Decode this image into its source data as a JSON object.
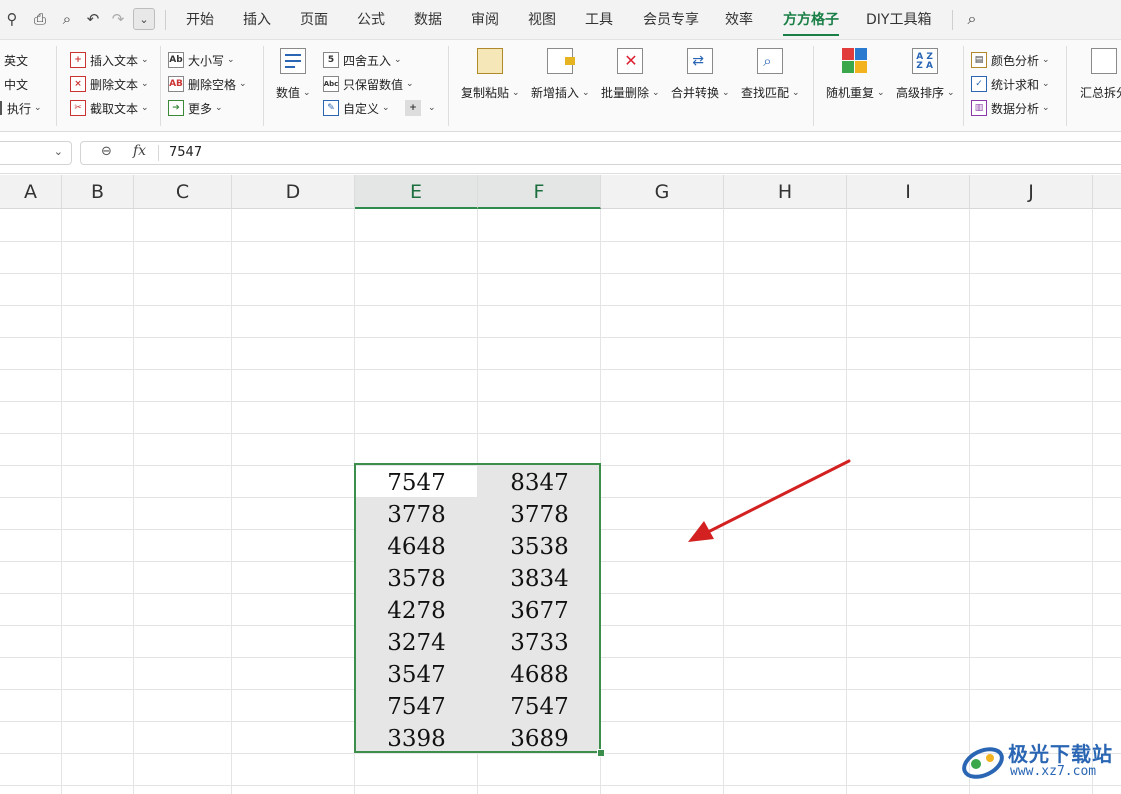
{
  "quick_access": [
    "pin-icon",
    "print-icon",
    "print-preview-icon",
    "undo-icon",
    "redo-icon"
  ],
  "tabs": [
    {
      "label": "开始",
      "active": false
    },
    {
      "label": "插入",
      "active": false
    },
    {
      "label": "页面",
      "active": false
    },
    {
      "label": "公式",
      "active": false
    },
    {
      "label": "数据",
      "active": false
    },
    {
      "label": "审阅",
      "active": false
    },
    {
      "label": "视图",
      "active": false
    },
    {
      "label": "工具",
      "active": false
    },
    {
      "label": "会员专享",
      "active": false
    },
    {
      "label": "效率",
      "active": false
    },
    {
      "label": "方方格子",
      "active": true
    },
    {
      "label": "DIY工具箱",
      "active": false
    }
  ],
  "ribbon": {
    "group1": [
      "英文",
      "中文",
      "执行"
    ],
    "group2": [
      "插入文本",
      "删除文本",
      "截取文本"
    ],
    "group3": [
      "大小写",
      "删除空格",
      "更多"
    ],
    "numeric_button": "数值",
    "group4": [
      "四舍五入",
      "只保留数值",
      "自定义"
    ],
    "plus_label": "+",
    "big_buttons": [
      "复制粘贴",
      "新增插入",
      "批量删除",
      "合并转换",
      "查找匹配"
    ],
    "big_buttons2": [
      "随机重复",
      "高级排序"
    ],
    "group5": [
      "颜色分析",
      "统计求和",
      "数据分析"
    ],
    "last_button": "汇总拆分"
  },
  "formula_bar": {
    "name_box": "",
    "fx_label": "fx",
    "value": "7547"
  },
  "columns": [
    "A",
    "B",
    "C",
    "D",
    "E",
    "F",
    "G",
    "H",
    "I",
    "J"
  ],
  "selected_columns": [
    "E",
    "F"
  ],
  "table": {
    "E": [
      "7547",
      "3778",
      "4648",
      "3578",
      "4278",
      "3274",
      "3547",
      "7547",
      "3398"
    ],
    "F": [
      "8347",
      "3778",
      "3538",
      "3834",
      "3677",
      "3733",
      "4688",
      "7547",
      "3689"
    ]
  },
  "watermark": {
    "title": "极光下载站",
    "url": "www.xz7.com"
  },
  "colors": {
    "accent": "#1a7f46",
    "selection_border": "#3c8f4a",
    "arrow": "#d32121",
    "watermark": "#2a66b3"
  }
}
